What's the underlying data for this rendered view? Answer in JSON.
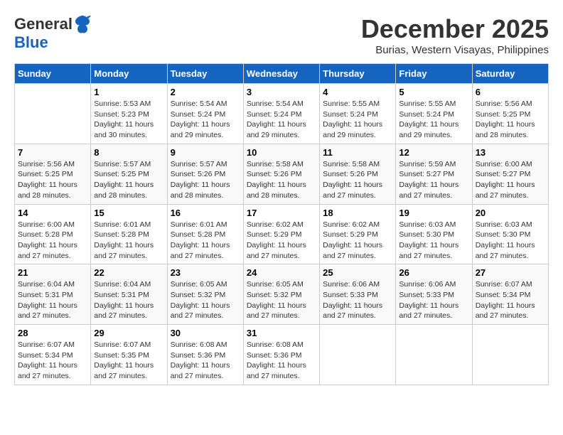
{
  "logo": {
    "line1": "General",
    "line2": "Blue"
  },
  "title": "December 2025",
  "location": "Burias, Western Visayas, Philippines",
  "days_header": [
    "Sunday",
    "Monday",
    "Tuesday",
    "Wednesday",
    "Thursday",
    "Friday",
    "Saturday"
  ],
  "weeks": [
    [
      {
        "num": "",
        "info": ""
      },
      {
        "num": "1",
        "info": "Sunrise: 5:53 AM\nSunset: 5:23 PM\nDaylight: 11 hours\nand 30 minutes."
      },
      {
        "num": "2",
        "info": "Sunrise: 5:54 AM\nSunset: 5:24 PM\nDaylight: 11 hours\nand 29 minutes."
      },
      {
        "num": "3",
        "info": "Sunrise: 5:54 AM\nSunset: 5:24 PM\nDaylight: 11 hours\nand 29 minutes."
      },
      {
        "num": "4",
        "info": "Sunrise: 5:55 AM\nSunset: 5:24 PM\nDaylight: 11 hours\nand 29 minutes."
      },
      {
        "num": "5",
        "info": "Sunrise: 5:55 AM\nSunset: 5:24 PM\nDaylight: 11 hours\nand 29 minutes."
      },
      {
        "num": "6",
        "info": "Sunrise: 5:56 AM\nSunset: 5:25 PM\nDaylight: 11 hours\nand 28 minutes."
      }
    ],
    [
      {
        "num": "7",
        "info": "Sunrise: 5:56 AM\nSunset: 5:25 PM\nDaylight: 11 hours\nand 28 minutes."
      },
      {
        "num": "8",
        "info": "Sunrise: 5:57 AM\nSunset: 5:25 PM\nDaylight: 11 hours\nand 28 minutes."
      },
      {
        "num": "9",
        "info": "Sunrise: 5:57 AM\nSunset: 5:26 PM\nDaylight: 11 hours\nand 28 minutes."
      },
      {
        "num": "10",
        "info": "Sunrise: 5:58 AM\nSunset: 5:26 PM\nDaylight: 11 hours\nand 28 minutes."
      },
      {
        "num": "11",
        "info": "Sunrise: 5:58 AM\nSunset: 5:26 PM\nDaylight: 11 hours\nand 27 minutes."
      },
      {
        "num": "12",
        "info": "Sunrise: 5:59 AM\nSunset: 5:27 PM\nDaylight: 11 hours\nand 27 minutes."
      },
      {
        "num": "13",
        "info": "Sunrise: 6:00 AM\nSunset: 5:27 PM\nDaylight: 11 hours\nand 27 minutes."
      }
    ],
    [
      {
        "num": "14",
        "info": "Sunrise: 6:00 AM\nSunset: 5:28 PM\nDaylight: 11 hours\nand 27 minutes."
      },
      {
        "num": "15",
        "info": "Sunrise: 6:01 AM\nSunset: 5:28 PM\nDaylight: 11 hours\nand 27 minutes."
      },
      {
        "num": "16",
        "info": "Sunrise: 6:01 AM\nSunset: 5:28 PM\nDaylight: 11 hours\nand 27 minutes."
      },
      {
        "num": "17",
        "info": "Sunrise: 6:02 AM\nSunset: 5:29 PM\nDaylight: 11 hours\nand 27 minutes."
      },
      {
        "num": "18",
        "info": "Sunrise: 6:02 AM\nSunset: 5:29 PM\nDaylight: 11 hours\nand 27 minutes."
      },
      {
        "num": "19",
        "info": "Sunrise: 6:03 AM\nSunset: 5:30 PM\nDaylight: 11 hours\nand 27 minutes."
      },
      {
        "num": "20",
        "info": "Sunrise: 6:03 AM\nSunset: 5:30 PM\nDaylight: 11 hours\nand 27 minutes."
      }
    ],
    [
      {
        "num": "21",
        "info": "Sunrise: 6:04 AM\nSunset: 5:31 PM\nDaylight: 11 hours\nand 27 minutes."
      },
      {
        "num": "22",
        "info": "Sunrise: 6:04 AM\nSunset: 5:31 PM\nDaylight: 11 hours\nand 27 minutes."
      },
      {
        "num": "23",
        "info": "Sunrise: 6:05 AM\nSunset: 5:32 PM\nDaylight: 11 hours\nand 27 minutes."
      },
      {
        "num": "24",
        "info": "Sunrise: 6:05 AM\nSunset: 5:32 PM\nDaylight: 11 hours\nand 27 minutes."
      },
      {
        "num": "25",
        "info": "Sunrise: 6:06 AM\nSunset: 5:33 PM\nDaylight: 11 hours\nand 27 minutes."
      },
      {
        "num": "26",
        "info": "Sunrise: 6:06 AM\nSunset: 5:33 PM\nDaylight: 11 hours\nand 27 minutes."
      },
      {
        "num": "27",
        "info": "Sunrise: 6:07 AM\nSunset: 5:34 PM\nDaylight: 11 hours\nand 27 minutes."
      }
    ],
    [
      {
        "num": "28",
        "info": "Sunrise: 6:07 AM\nSunset: 5:34 PM\nDaylight: 11 hours\nand 27 minutes."
      },
      {
        "num": "29",
        "info": "Sunrise: 6:07 AM\nSunset: 5:35 PM\nDaylight: 11 hours\nand 27 minutes."
      },
      {
        "num": "30",
        "info": "Sunrise: 6:08 AM\nSunset: 5:36 PM\nDaylight: 11 hours\nand 27 minutes."
      },
      {
        "num": "31",
        "info": "Sunrise: 6:08 AM\nSunset: 5:36 PM\nDaylight: 11 hours\nand 27 minutes."
      },
      {
        "num": "",
        "info": ""
      },
      {
        "num": "",
        "info": ""
      },
      {
        "num": "",
        "info": ""
      }
    ]
  ]
}
